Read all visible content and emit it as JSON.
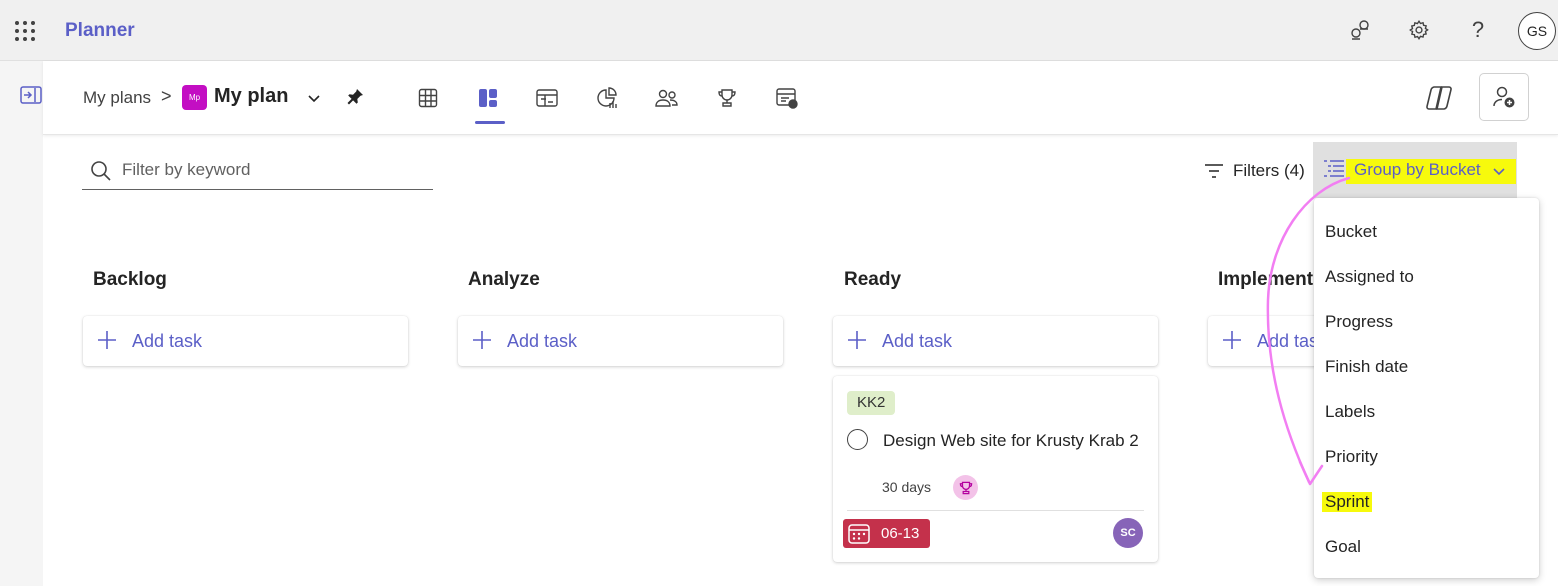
{
  "app": {
    "title": "Planner",
    "user_initials": "GS"
  },
  "icons": {
    "waffle": "app-launcher-icon",
    "share": "share-icon",
    "settings": "gear-icon",
    "help": "help-icon",
    "rail": "collapse-rail-icon",
    "pin": "pin-icon",
    "copilot": "copilot-icon",
    "add_member": "add-member-icon",
    "search": "search-icon",
    "filter": "filter-icon",
    "group": "group-by-icon",
    "plus": "plus-icon",
    "calendar": "calendar-icon",
    "trophy": "trophy-icon"
  },
  "breadcrumb": {
    "parent": "My plans",
    "separator": ">",
    "plan_badge": "Mp",
    "plan_name": "My plan"
  },
  "view_tabs": [
    {
      "name": "grid-view-tab",
      "icon": "grid-icon",
      "active": false
    },
    {
      "name": "board-view-tab",
      "icon": "board-icon",
      "active": true
    },
    {
      "name": "schedule-view-tab",
      "icon": "schedule-icon",
      "active": false
    },
    {
      "name": "charts-view-tab",
      "icon": "charts-icon",
      "active": false
    },
    {
      "name": "people-view-tab",
      "icon": "people-icon",
      "active": false
    },
    {
      "name": "goals-view-tab",
      "icon": "trophy-icon",
      "active": false
    },
    {
      "name": "timeline-view-tab",
      "icon": "timeline-icon",
      "active": false
    }
  ],
  "toolbar": {
    "search_placeholder": "Filter by keyword",
    "filters_label": "Filters (4)",
    "group_by_label": "Group by Bucket"
  },
  "buckets": [
    {
      "title": "Backlog",
      "add_label": "Add task"
    },
    {
      "title": "Analyze",
      "add_label": "Add task"
    },
    {
      "title": "Ready",
      "add_label": "Add task"
    },
    {
      "title": "Implement",
      "add_label": "Add task"
    }
  ],
  "task": {
    "tag": "KK2",
    "title": "Design Web site for Krusty Krab 2",
    "duration": "30 days",
    "due": "06-13",
    "assignee": "SC"
  },
  "group_menu": {
    "items": [
      "Bucket",
      "Assigned to",
      "Progress",
      "Finish date",
      "Labels",
      "Priority",
      "Sprint",
      "Goal"
    ],
    "highlighted": "Sprint"
  },
  "colors": {
    "accent": "#5b5fc7",
    "highlight": "#f7fa0c",
    "annotation": "#f27ef2",
    "due_overdue": "#c4314b",
    "plan_badge": "#c30ec3",
    "tag_bg": "#dfeeca",
    "avatar": "#8764b8"
  }
}
